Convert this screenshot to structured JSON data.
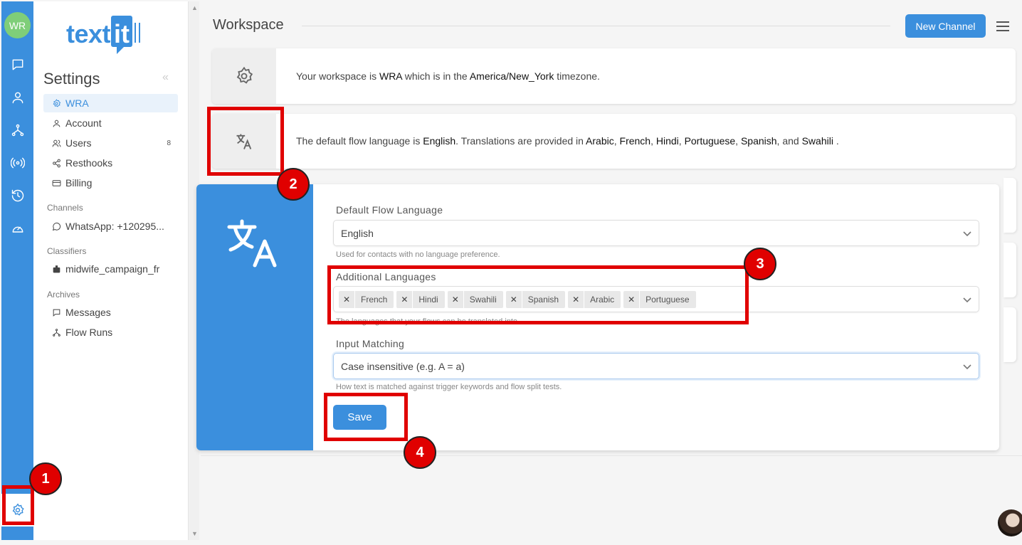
{
  "rail": {
    "avatar_initials": "WR",
    "icons": [
      "chat-icon",
      "contacts-icon",
      "flows-icon",
      "channels-icon",
      "history-icon",
      "dashboard-icon"
    ],
    "settings_icon": "gear-icon"
  },
  "sidebar": {
    "logo": "textit",
    "title": "Settings",
    "collapse": "«",
    "items": [
      {
        "label": "WRA",
        "icon": "gear-icon",
        "active": true
      },
      {
        "label": "Account",
        "icon": "user-icon"
      },
      {
        "label": "Users",
        "icon": "users-icon",
        "count": "8"
      },
      {
        "label": "Resthooks",
        "icon": "share-icon"
      },
      {
        "label": "Billing",
        "icon": "card-icon"
      }
    ],
    "channels_label": "Channels",
    "channels": [
      {
        "label": "WhatsApp: +120295...",
        "icon": "whatsapp-icon"
      }
    ],
    "classifiers_label": "Classifiers",
    "classifiers": [
      {
        "label": "midwife_campaign_fr",
        "icon": "robot-icon"
      }
    ],
    "archives_label": "Archives",
    "archives": [
      {
        "label": "Messages",
        "icon": "message-icon"
      },
      {
        "label": "Flow Runs",
        "icon": "flow-icon"
      }
    ]
  },
  "header": {
    "title": "Workspace",
    "new_channel_label": "New Channel",
    "menu_icon": "hamburger-icon"
  },
  "workspace_card": {
    "prefix": "Your workspace is ",
    "workspace": "WRA",
    "middle": " which is in the ",
    "timezone": "America/New_York",
    "suffix": " timezone."
  },
  "language_card": {
    "prefix": "The default flow language is ",
    "default_language": "English",
    "middle": ". Translations are provided in ",
    "lang1": "Arabic",
    "sep1": ", ",
    "lang2": "French",
    "sep2": ", ",
    "lang3": "Hindi",
    "sep3": ", ",
    "lang4": "Portuguese",
    "sep4": ", ",
    "lang5": "Spanish",
    "sep5": ", and ",
    "lang6": "Swahili",
    "suffix": " ."
  },
  "language_form": {
    "default_label": "Default Flow Language",
    "default_value": "English",
    "default_help": "Used for contacts with no language preference.",
    "additional_label": "Additional Languages",
    "additional_values": [
      "French",
      "Hindi",
      "Swahili",
      "Spanish",
      "Arabic",
      "Portuguese"
    ],
    "additional_help": "The languages that your flows can be translated into.",
    "matching_label": "Input Matching",
    "matching_value": "Case insensitive (e.g. A = a)",
    "matching_help": "How text is matched against trigger keywords and flow split tests.",
    "save_label": "Save",
    "remove_glyph": "✕"
  },
  "annotations": [
    "1",
    "2",
    "3",
    "4"
  ],
  "colors": {
    "accent": "#3b8fdd",
    "highlight": "#e00000"
  }
}
